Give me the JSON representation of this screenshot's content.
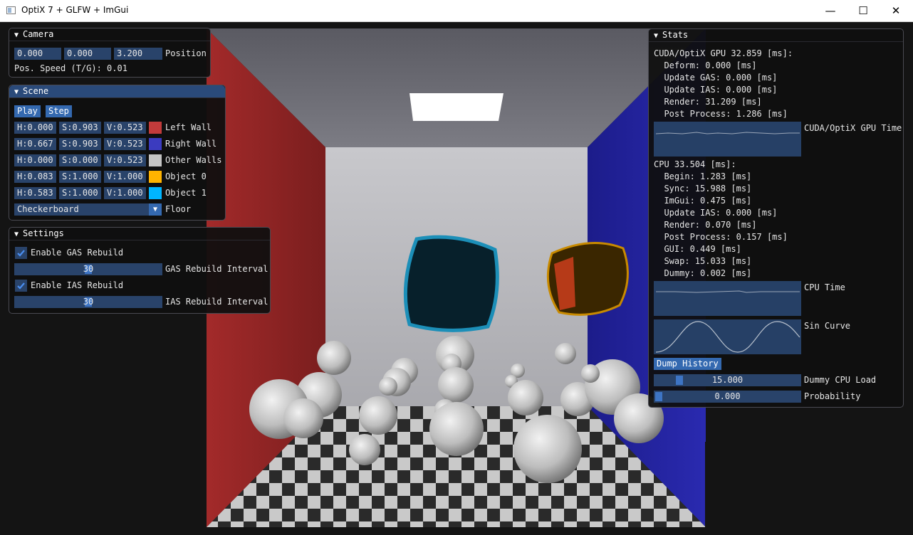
{
  "window": {
    "title": "OptiX 7 + GLFW + ImGui",
    "minimize": "—",
    "maximize": "☐",
    "close": "✕"
  },
  "camera": {
    "header": "Camera",
    "pos_x": "0.000",
    "pos_y": "0.000",
    "pos_z": "3.200",
    "pos_label": "Position",
    "speed_text": "Pos. Speed (T/G): 0.01"
  },
  "scene": {
    "header": "Scene",
    "play": "Play",
    "step": "Step",
    "rows": [
      {
        "h": "H:0.000",
        "s": "S:0.903",
        "v": "V:0.523",
        "color": "#c23b3b",
        "label": "Left Wall"
      },
      {
        "h": "H:0.667",
        "s": "S:0.903",
        "v": "V:0.523",
        "color": "#3b3bbf",
        "label": "Right Wall"
      },
      {
        "h": "H:0.000",
        "s": "S:0.000",
        "v": "V:0.523",
        "color": "#c4c4c4",
        "label": "Other Walls"
      },
      {
        "h": "H:0.083",
        "s": "S:1.000",
        "v": "V:1.000",
        "color": "#ffb300",
        "label": "Object 0"
      },
      {
        "h": "H:0.583",
        "s": "S:1.000",
        "v": "V:1.000",
        "color": "#00b5ff",
        "label": "Object 1"
      }
    ],
    "floor_value": "Checkerboard",
    "floor_label": "Floor"
  },
  "settings": {
    "header": "Settings",
    "gas_rebuild": "Enable GAS Rebuild",
    "gas_interval_value": "30",
    "gas_interval_label": "GAS Rebuild Interval",
    "ias_rebuild": "Enable IAS Rebuild",
    "ias_interval_value": "30",
    "ias_interval_label": "IAS Rebuild Interval"
  },
  "stats": {
    "header": "Stats",
    "gpu_lines": [
      "CUDA/OptiX GPU 32.859 [ms]:",
      "  Deform: 0.000 [ms]",
      "  Update GAS: 0.000 [ms]",
      "  Update IAS: 0.000 [ms]",
      "  Render: 31.209 [ms]",
      "  Post Process: 1.286 [ms]"
    ],
    "gpu_plot_label": "CUDA/OptiX GPU Time",
    "cpu_lines": [
      "CPU 33.504 [ms]:",
      "  Begin: 1.283 [ms]",
      "  Sync: 15.988 [ms]",
      "  ImGui: 0.475 [ms]",
      "  Update IAS: 0.000 [ms]",
      "  Render: 0.070 [ms]",
      "  Post Process: 0.157 [ms]",
      "  GUI: 0.449 [ms]",
      "  Swap: 15.033 [ms]",
      "  Dummy: 0.002 [ms]"
    ],
    "cpu_plot_label": "CPU Time",
    "sin_plot_label": "Sin Curve",
    "dump_button": "Dump History",
    "dummy_load_value": "15.000",
    "dummy_load_fraction": 0.15,
    "dummy_load_label": "Dummy CPU Load",
    "probability_value": "0.000",
    "probability_label": "Probability",
    "probability_fraction": 0.0
  }
}
